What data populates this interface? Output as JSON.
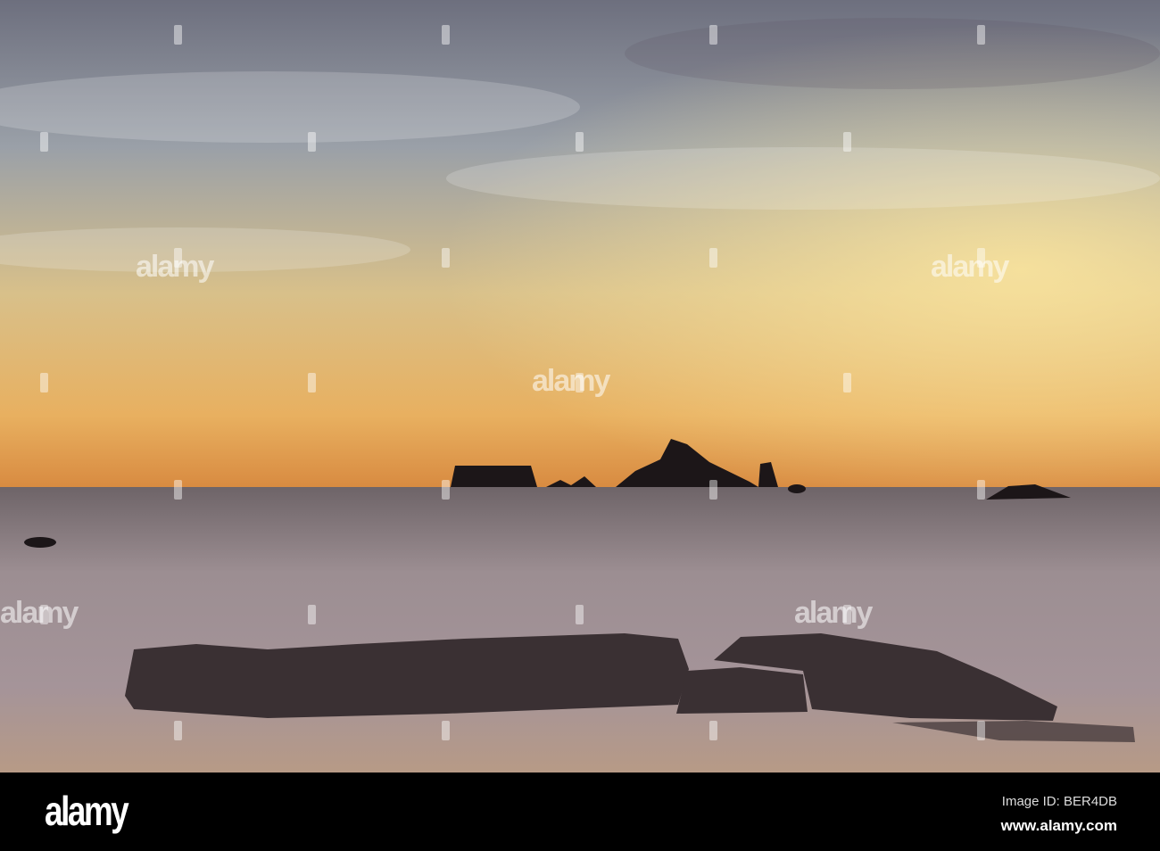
{
  "watermark": {
    "text": "alamy"
  },
  "footer": {
    "logo": "alamy",
    "image_id": "Image ID: BER4DB",
    "website": "www.alamy.com"
  },
  "colors": {
    "sky_top": "#6f7585",
    "horizon": "#e8a860",
    "sea": "#8a7a80",
    "rocks": "#2a2426"
  }
}
